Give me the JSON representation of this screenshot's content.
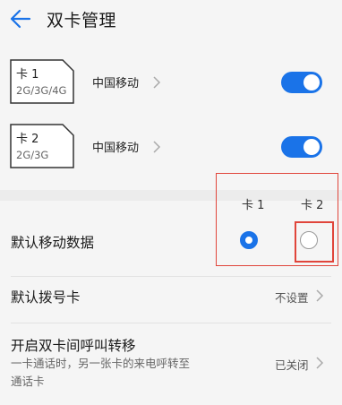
{
  "header": {
    "title": "双卡管理"
  },
  "sims": [
    {
      "name": "卡 1",
      "bands": "2G/3G/4G",
      "carrier": "中国移动",
      "enabled": true
    },
    {
      "name": "卡 2",
      "bands": "2G/3G",
      "carrier": "中国移动",
      "enabled": true
    }
  ],
  "mobile_data": {
    "col1": "卡 1",
    "col2": "卡 2",
    "label": "默认移动数据",
    "selected": "卡 1"
  },
  "default_dial": {
    "label": "默认拨号卡",
    "value": "不设置"
  },
  "call_forward": {
    "label": "开启双卡间呼叫转移",
    "desc_line1": "一卡通话时，另一张卡的来电呼转至",
    "desc_line2": "通话卡",
    "value": "已关闭"
  },
  "colors": {
    "accent": "#1a73e8",
    "highlight": "#e0453b"
  }
}
